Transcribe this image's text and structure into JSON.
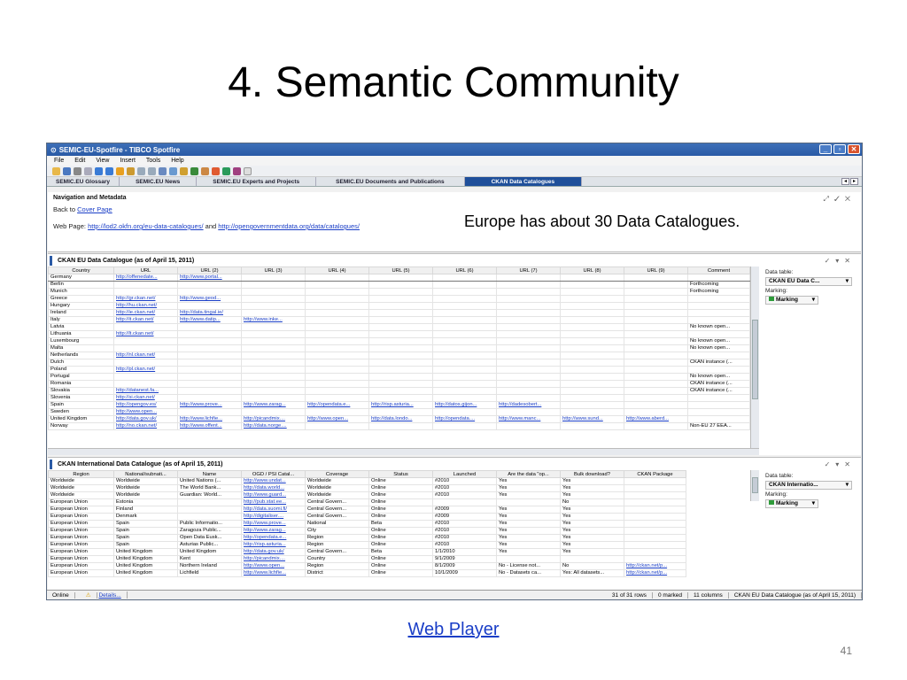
{
  "slide": {
    "title": "4. Semantic Community",
    "web_player": "Web Player",
    "page_number": "41"
  },
  "window": {
    "title": "SEMIC-EU-Spotfire - TIBCO Spotfire"
  },
  "menu": [
    "File",
    "Edit",
    "View",
    "Insert",
    "Tools",
    "Help"
  ],
  "tabs": [
    "SEMIC.EU Glossary",
    "SEMIC.EU News",
    "SEMIC.EU Experts and Projects",
    "SEMIC.EU Documents and Publications",
    "CKAN Data Catalogues"
  ],
  "nav": {
    "title": "Navigation and Metadata",
    "back_prefix": "Back to ",
    "back_link": "Cover Page",
    "web_prefix": "Web Page: ",
    "link1": "http://lod2.okfn.org/eu-data-catalogues/",
    "and": " and ",
    "link2": "http://opengovernmentdata.org/data/catalogues/",
    "note": "Europe has about 30 Data Catalogues."
  },
  "eu_table": {
    "title": "CKAN EU Data Catalogue (as of April 15, 2011)",
    "columns": [
      "Country",
      "URL",
      "URL (2)",
      "URL (3)",
      "URL (4)",
      "URL (5)",
      "URL (6)",
      "URL (7)",
      "URL (8)",
      "URL (9)",
      "Comment"
    ],
    "rows": [
      [
        "Germany",
        "http://offenedate...",
        "http://www.portal...",
        "",
        "",
        "",
        "",
        "",
        "",
        "",
        ""
      ],
      [
        "Berlin",
        "",
        "",
        "",
        "",
        "",
        "",
        "",
        "",
        "",
        "Forthcoming"
      ],
      [
        "Munich",
        "",
        "",
        "",
        "",
        "",
        "",
        "",
        "",
        "",
        "Forthcoming"
      ],
      [
        "Greece",
        "http://gr.ckan.net/",
        "http://www.geod...",
        "",
        "",
        "",
        "",
        "",
        "",
        "",
        ""
      ],
      [
        "Hungary",
        "http://hu.ckan.net/",
        "",
        "",
        "",
        "",
        "",
        "",
        "",
        "",
        ""
      ],
      [
        "Ireland",
        "http://ie.ckan.net/",
        "http://data.tingal.ie/",
        "",
        "",
        "",
        "",
        "",
        "",
        "",
        ""
      ],
      [
        "Italy",
        "http://it.ckan.net/",
        "http://www.datip...",
        "http://www.inke...",
        "",
        "",
        "",
        "",
        "",
        "",
        ""
      ],
      [
        "Latvia",
        "",
        "",
        "",
        "",
        "",
        "",
        "",
        "",
        "",
        "No known open..."
      ],
      [
        "Lithuania",
        "http://lt.ckan.net/",
        "",
        "",
        "",
        "",
        "",
        "",
        "",
        "",
        ""
      ],
      [
        "Luxembourg",
        "",
        "",
        "",
        "",
        "",
        "",
        "",
        "",
        "",
        "No known open..."
      ],
      [
        "Malta",
        "",
        "",
        "",
        "",
        "",
        "",
        "",
        "",
        "",
        "No known open..."
      ],
      [
        "Netherlands",
        "http://nl.ckan.net/",
        "",
        "",
        "",
        "",
        "",
        "",
        "",
        "",
        ""
      ],
      [
        "Dutch",
        "",
        "",
        "",
        "",
        "",
        "",
        "",
        "",
        "",
        "CKAN instance (..."
      ],
      [
        "Poland",
        "http://pl.ckan.net/",
        "",
        "",
        "",
        "",
        "",
        "",
        "",
        "",
        ""
      ],
      [
        "Portugal",
        "",
        "",
        "",
        "",
        "",
        "",
        "",
        "",
        "",
        "No known open..."
      ],
      [
        "Romania",
        "",
        "",
        "",
        "",
        "",
        "",
        "",
        "",
        "",
        "CKAN instance (..."
      ],
      [
        "Slovakia",
        "http://datanest.fa...",
        "",
        "",
        "",
        "",
        "",
        "",
        "",
        "",
        "CKAN instance (..."
      ],
      [
        "Slovenia",
        "http://si.ckan.net/",
        "",
        "",
        "",
        "",
        "",
        "",
        "",
        "",
        ""
      ],
      [
        "Spain",
        "http://opengov.es/",
        "http://www.prove...",
        "http://www.zarag...",
        "http://opendata.e...",
        "http://risp.asturia...",
        "http://datos.gijon...",
        "http://dadesobert...",
        "",
        "",
        ""
      ],
      [
        "Sweden",
        "http://www.open...",
        "",
        "",
        "",
        "",
        "",
        "",
        "",
        "",
        ""
      ],
      [
        "United Kingdom",
        "http://data.gov.uk/",
        "http://www.lichfie...",
        "http://picandmix....",
        "http://www.open...",
        "http://data.londo...",
        "http://opendata....",
        "http://www.manc...",
        "http://www.sund...",
        "http://www.aberd...",
        ""
      ],
      [
        "Norway",
        "http://no.ckan.net/",
        "http://www.offent...",
        "http://data.norge....",
        "",
        "",
        "",
        "",
        "",
        "",
        "Non-EU 27 EEA..."
      ]
    ]
  },
  "intl_table": {
    "title": "CKAN International Data Catalogue (as of April 15, 2011)",
    "columns": [
      "Region",
      "National/subnati...",
      "Name",
      "OGD / PSI Catal...",
      "Coverage",
      "Status",
      "Launched",
      "Are the data \"op...",
      "Bulk download?",
      "CKAN Package"
    ],
    "rows": [
      [
        "Worldwide",
        "Worldwide",
        "United Nations (...",
        "http://www.undat...",
        "Worldwide",
        "Online",
        "#2010",
        "Yes",
        "Yes",
        ""
      ],
      [
        "Worldwide",
        "Worldwide",
        "The World Bank...",
        "http://data.world...",
        "Worldwide",
        "Online",
        "#2010",
        "Yes",
        "Yes",
        ""
      ],
      [
        "Worldwide",
        "Worldwide",
        "Guardian: World...",
        "http://www.guard...",
        "Worldwide",
        "Online",
        "#2010",
        "Yes",
        "Yes",
        ""
      ],
      [
        "European Union",
        "Estonia",
        "",
        "http://pub.stat.ee...",
        "Central Govern...",
        "Online",
        "",
        "",
        "No",
        ""
      ],
      [
        "European Union",
        "Finland",
        "",
        "http://data.suomi.fi/",
        "Central Govern...",
        "Online",
        "#2009",
        "Yes",
        "Yes",
        ""
      ],
      [
        "European Union",
        "Denmark",
        "",
        "http://digitaliser....",
        "Central Govern...",
        "Online",
        "#2009",
        "Yes",
        "Yes",
        ""
      ],
      [
        "European Union",
        "Spain",
        "Public Informatio...",
        "http://www.prove...",
        "National",
        "Beta",
        "#2010",
        "Yes",
        "Yes",
        ""
      ],
      [
        "European Union",
        "Spain",
        "Zaragoza Public...",
        "http://www.zarag...",
        "City",
        "Online",
        "#2010",
        "Yes",
        "Yes",
        ""
      ],
      [
        "European Union",
        "Spain",
        "Open Data Eusk...",
        "http://opendata.e...",
        "Region",
        "Online",
        "#2010",
        "Yes",
        "Yes",
        ""
      ],
      [
        "European Union",
        "Spain",
        "Asturias Public...",
        "http://risp.asturia...",
        "Region",
        "Online",
        "#2010",
        "Yes",
        "Yes",
        ""
      ],
      [
        "European Union",
        "United Kingdom",
        "United Kingdom",
        "http://data.gov.uk/",
        "Central Govern...",
        "Beta",
        "1/1/2010",
        "Yes",
        "Yes",
        ""
      ],
      [
        "European Union",
        "United Kingdom",
        "Kent",
        "http://picandmix....",
        "Country",
        "Online",
        "9/1/2009",
        "",
        "",
        ""
      ],
      [
        "European Union",
        "United Kingdom",
        "Northern Ireland",
        "http://www.open...",
        "Region",
        "Online",
        "8/1/2009",
        "No - License not...",
        "No",
        "http://ckan.net/p..."
      ],
      [
        "European Union",
        "United Kingdom",
        "Lichfield",
        "http://www.lichfie...",
        "District",
        "Online",
        "10/1/2009",
        "No - Datasets ca...",
        "Yes: All datasets...",
        "http://ckan.net/p..."
      ]
    ]
  },
  "side1": {
    "data_table_label": "Data table:",
    "data_table_value": "CKAN EU Data C...",
    "marking_label": "Marking:",
    "marking_value": "Marking"
  },
  "side2": {
    "data_table_label": "Data table:",
    "data_table_value": "CKAN Internatio...",
    "marking_label": "Marking:",
    "marking_value": "Marking"
  },
  "status": {
    "online": "Online",
    "details": "Details...",
    "rows": "31 of 31 rows",
    "marked": "0 marked",
    "columns": "11 columns",
    "table": "CKAN EU Data Catalogue (as of April 15, 2011)"
  }
}
